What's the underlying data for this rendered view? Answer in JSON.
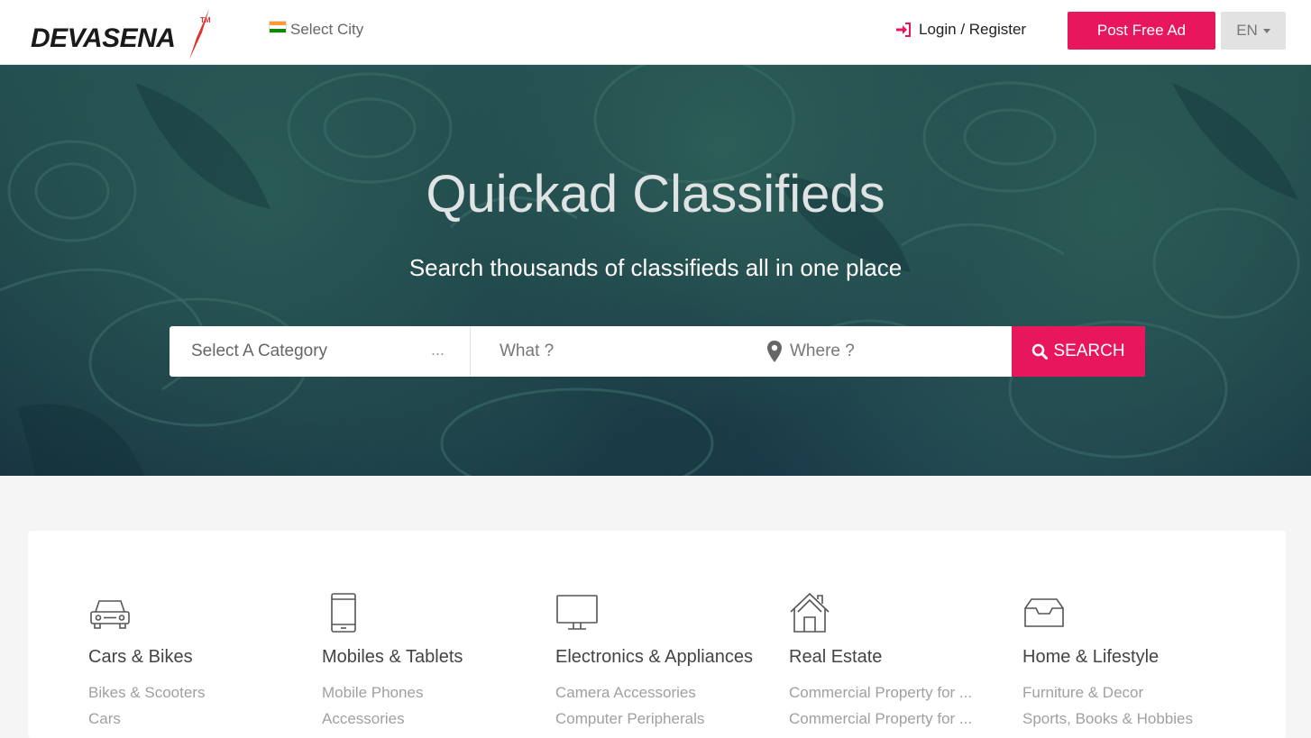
{
  "header": {
    "logo_text": "DEVASENA",
    "logo_tm": "TM",
    "city_label": "Select City",
    "login_label": "Login / Register",
    "post_ad_label": "Post Free Ad",
    "language_label": "EN",
    "accent_color": "#e8175d"
  },
  "hero": {
    "title": "Quickad Classifieds",
    "subtitle": "Search thousands of classifieds all in one place"
  },
  "search": {
    "category_placeholder": "Select A Category",
    "category_more": "...",
    "what_placeholder": "What ?",
    "where_placeholder": "Where ?",
    "button_label": "SEARCH"
  },
  "categories": [
    {
      "icon": "car-icon",
      "title": "Cars & Bikes",
      "items": [
        "Bikes & Scooters",
        "Cars"
      ]
    },
    {
      "icon": "mobile-icon",
      "title": "Mobiles & Tablets",
      "items": [
        "Mobile Phones",
        "Accessories"
      ]
    },
    {
      "icon": "monitor-icon",
      "title": "Electronics & Appliances",
      "items": [
        "Camera Accessories",
        "Computer Peripherals"
      ]
    },
    {
      "icon": "house-icon",
      "title": "Real Estate",
      "items": [
        "Commercial Property for ...",
        "Commercial Property for ..."
      ]
    },
    {
      "icon": "inbox-icon",
      "title": "Home & Lifestyle",
      "items": [
        "Furniture & Decor",
        "Sports, Books & Hobbies"
      ]
    }
  ]
}
